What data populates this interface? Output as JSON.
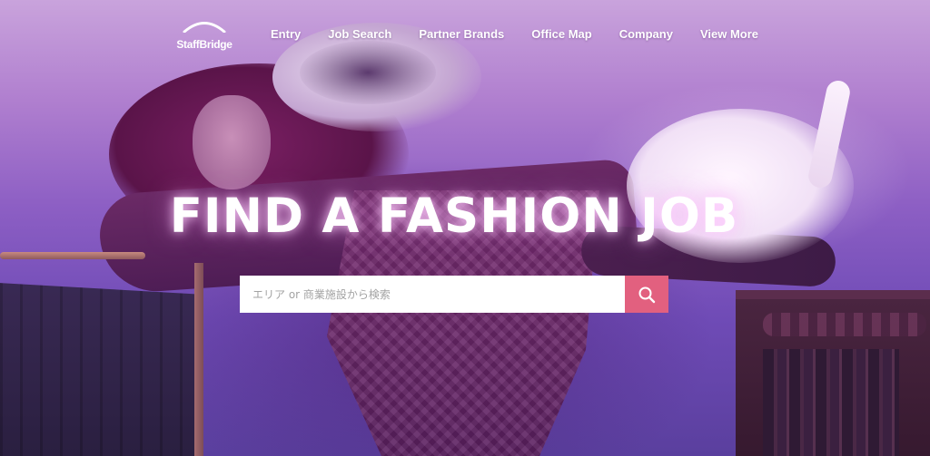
{
  "brand": {
    "logo_text": "StaffBridge"
  },
  "nav": {
    "items": [
      {
        "label": "Entry"
      },
      {
        "label": "Job Search"
      },
      {
        "label": "Partner Brands"
      },
      {
        "label": "Office Map"
      },
      {
        "label": "Company"
      },
      {
        "label": "View More"
      }
    ]
  },
  "hero": {
    "headline": "FIND A FASHION JOB"
  },
  "search": {
    "placeholder": "エリア or 商業施設から検索",
    "value": "",
    "button_icon": "search-icon",
    "button_color": "#e2607f"
  },
  "colors": {
    "tint": "#8d5fc4",
    "text": "#ffffff"
  }
}
